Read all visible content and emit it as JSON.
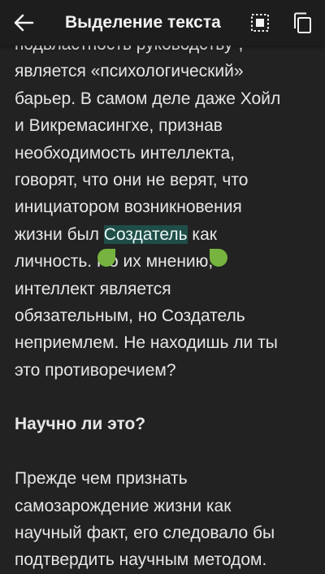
{
  "topbar": {
    "title": "Выделение текста",
    "icons": [
      "arrow-back-icon",
      "select-all-icon",
      "copy-icon"
    ]
  },
  "article": {
    "lines": [
      "подвластность руководству”,",
      "является «психологический»",
      "барьер. В самом деле даже Хойл",
      "и Викремасингхе, признав",
      "необходимость интеллекта,",
      "говорят, что они не верят, что",
      "инициатором возникновения"
    ],
    "sel_line_pre": "жизни был ",
    "selected_text": "Создатель",
    "sel_line_post": " как",
    "lines_after": [
      "личность. По их мнению,",
      "интеллект является",
      "обязательным, но Создатель",
      "неприемлем. Не находишь ли ты",
      "это противоречием?"
    ],
    "heading": "Научно ли это?",
    "para2": [
      "Прежде чем признать",
      "самозарождение жизни как",
      "научный факт, его следовало бы",
      "подтвердить научным методом."
    ]
  },
  "colors": {
    "background": "#222222",
    "selection": "#1f4e48",
    "handles": "#76b43f"
  }
}
